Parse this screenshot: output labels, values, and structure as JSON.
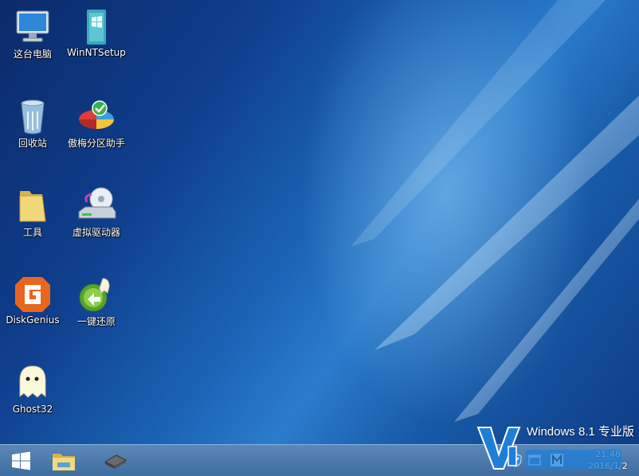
{
  "desktop": {
    "icons": [
      {
        "label": "这台电脑",
        "icon": "computer-icon"
      },
      {
        "label": "WinNTSetup",
        "icon": "winntsetup-icon"
      },
      {
        "label": "回收站",
        "icon": "recycle-bin-icon"
      },
      {
        "label": "傲梅分区助手",
        "icon": "partition-assistant-icon"
      },
      {
        "label": "工具",
        "icon": "folder-icon"
      },
      {
        "label": "虚拟驱动器",
        "icon": "virtual-drive-icon"
      },
      {
        "label": "DiskGenius",
        "icon": "diskgenius-icon"
      },
      {
        "label": "一键还原",
        "icon": "one-key-restore-icon"
      },
      {
        "label": "Ghost32",
        "icon": "ghost-icon"
      }
    ],
    "watermark": "Windows 8.1 专业版"
  },
  "taskbar": {
    "buttons": [
      "start-icon",
      "file-explorer-icon",
      "device-chip-icon"
    ],
    "clock": {
      "time": "21:48",
      "date": "2016/1/2"
    }
  },
  "colors": {
    "taskbar": "#4a79ab",
    "desktop_accent": "#1b63b4"
  }
}
